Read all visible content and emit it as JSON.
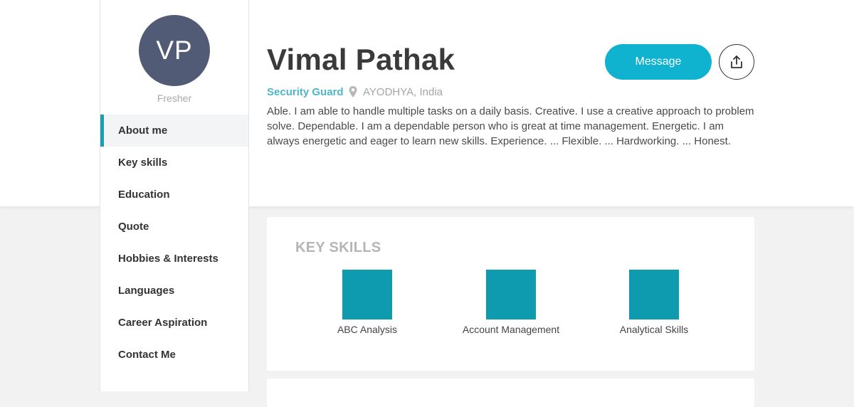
{
  "profile": {
    "initials": "VP",
    "status": "Fresher",
    "name": "Vimal Pathak",
    "job_title": "Security Guard",
    "location": "AYODHYA, India",
    "bio": "Able. I am able to handle multiple tasks on a daily basis. Creative. I use a creative approach to problem solve. Dependable. I am a dependable person who is great at time management. Energetic. I am always energetic and eager to learn new skills. Experience. ... Flexible. ... Hardworking. ... Honest."
  },
  "actions": {
    "message_label": "Message",
    "share_icon": "share-upload-icon"
  },
  "sidebar": {
    "items": [
      {
        "label": "About me",
        "active": true
      },
      {
        "label": "Key skills"
      },
      {
        "label": "Education"
      },
      {
        "label": "Quote"
      },
      {
        "label": "Hobbies & Interests"
      },
      {
        "label": "Languages"
      },
      {
        "label": "Career Aspiration"
      },
      {
        "label": "Contact Me"
      }
    ]
  },
  "key_skills": {
    "title": "KEY SKILLS",
    "items": [
      {
        "label": "ABC Analysis"
      },
      {
        "label": "Account Management"
      },
      {
        "label": "Analytical Skills"
      }
    ]
  },
  "colors": {
    "accent": "#10b3cf",
    "skill_tile": "#0e9bb0",
    "avatar_bg": "#515b76",
    "job_title": "#4fb5c7"
  }
}
